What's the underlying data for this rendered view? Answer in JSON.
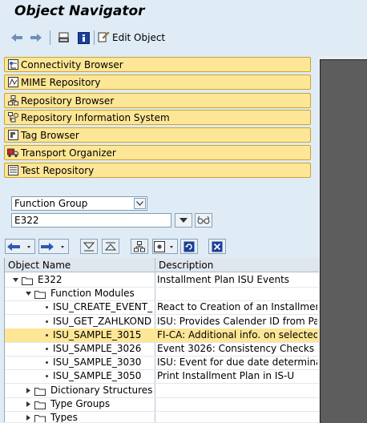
{
  "window": {
    "title": "Object Navigator"
  },
  "toolbar": {
    "edit_object_label": "Edit Object"
  },
  "nav_buttons": [
    {
      "label": "Connectivity Browser",
      "icon": "connectivity-icon"
    },
    {
      "label": "MIME Repository",
      "icon": "mime-icon"
    },
    {
      "label": "Repository Browser",
      "icon": "repository-browser-icon"
    },
    {
      "label": "Repository Information System",
      "icon": "repository-info-icon"
    },
    {
      "label": "Tag Browser",
      "icon": "tag-icon"
    },
    {
      "label": "Transport Organizer",
      "icon": "truck-icon"
    },
    {
      "label": "Test Repository",
      "icon": "test-repository-icon"
    }
  ],
  "object_type": {
    "selected": "Function Group"
  },
  "object_name": {
    "value": "E322"
  },
  "tree": {
    "columns": [
      "Object Name",
      "Description"
    ],
    "rows": [
      {
        "name": "E322",
        "desc": "Installment Plan ISU Events",
        "level": 0,
        "type": "folder",
        "expanded": true
      },
      {
        "name": "Function Modules",
        "desc": "",
        "level": 1,
        "type": "folder",
        "expanded": true
      },
      {
        "name": "ISU_CREATE_EVENT_",
        "desc": "React to Creation of an Installment",
        "level": 2,
        "type": "item"
      },
      {
        "name": "ISU_GET_ZAHLKOND",
        "desc": "ISU: Provides Calender ID from Payi",
        "level": 2,
        "type": "item"
      },
      {
        "name": "ISU_SAMPLE_3015",
        "desc": "FI-CA: Additional info. on selected i",
        "level": 2,
        "type": "item",
        "selected": true
      },
      {
        "name": "ISU_SAMPLE_3026",
        "desc": "Event 3026: Consistency Checks",
        "level": 2,
        "type": "item"
      },
      {
        "name": "ISU_SAMPLE_3030",
        "desc": "ISU: Event for due date determinat",
        "level": 2,
        "type": "item"
      },
      {
        "name": "ISU_SAMPLE_3050",
        "desc": "Print Installment Plan in IS-U",
        "level": 2,
        "type": "item"
      },
      {
        "name": "Dictionary Structures",
        "desc": "",
        "level": 1,
        "type": "folder",
        "expanded": false
      },
      {
        "name": "Type Groups",
        "desc": "",
        "level": 1,
        "type": "folder",
        "expanded": false
      },
      {
        "name": "Types",
        "desc": "",
        "level": 1,
        "type": "folder",
        "expanded": false
      }
    ]
  },
  "colors": {
    "selected_row": "#fde695",
    "nav_button": "#fde695",
    "background": "#dfebf5"
  }
}
